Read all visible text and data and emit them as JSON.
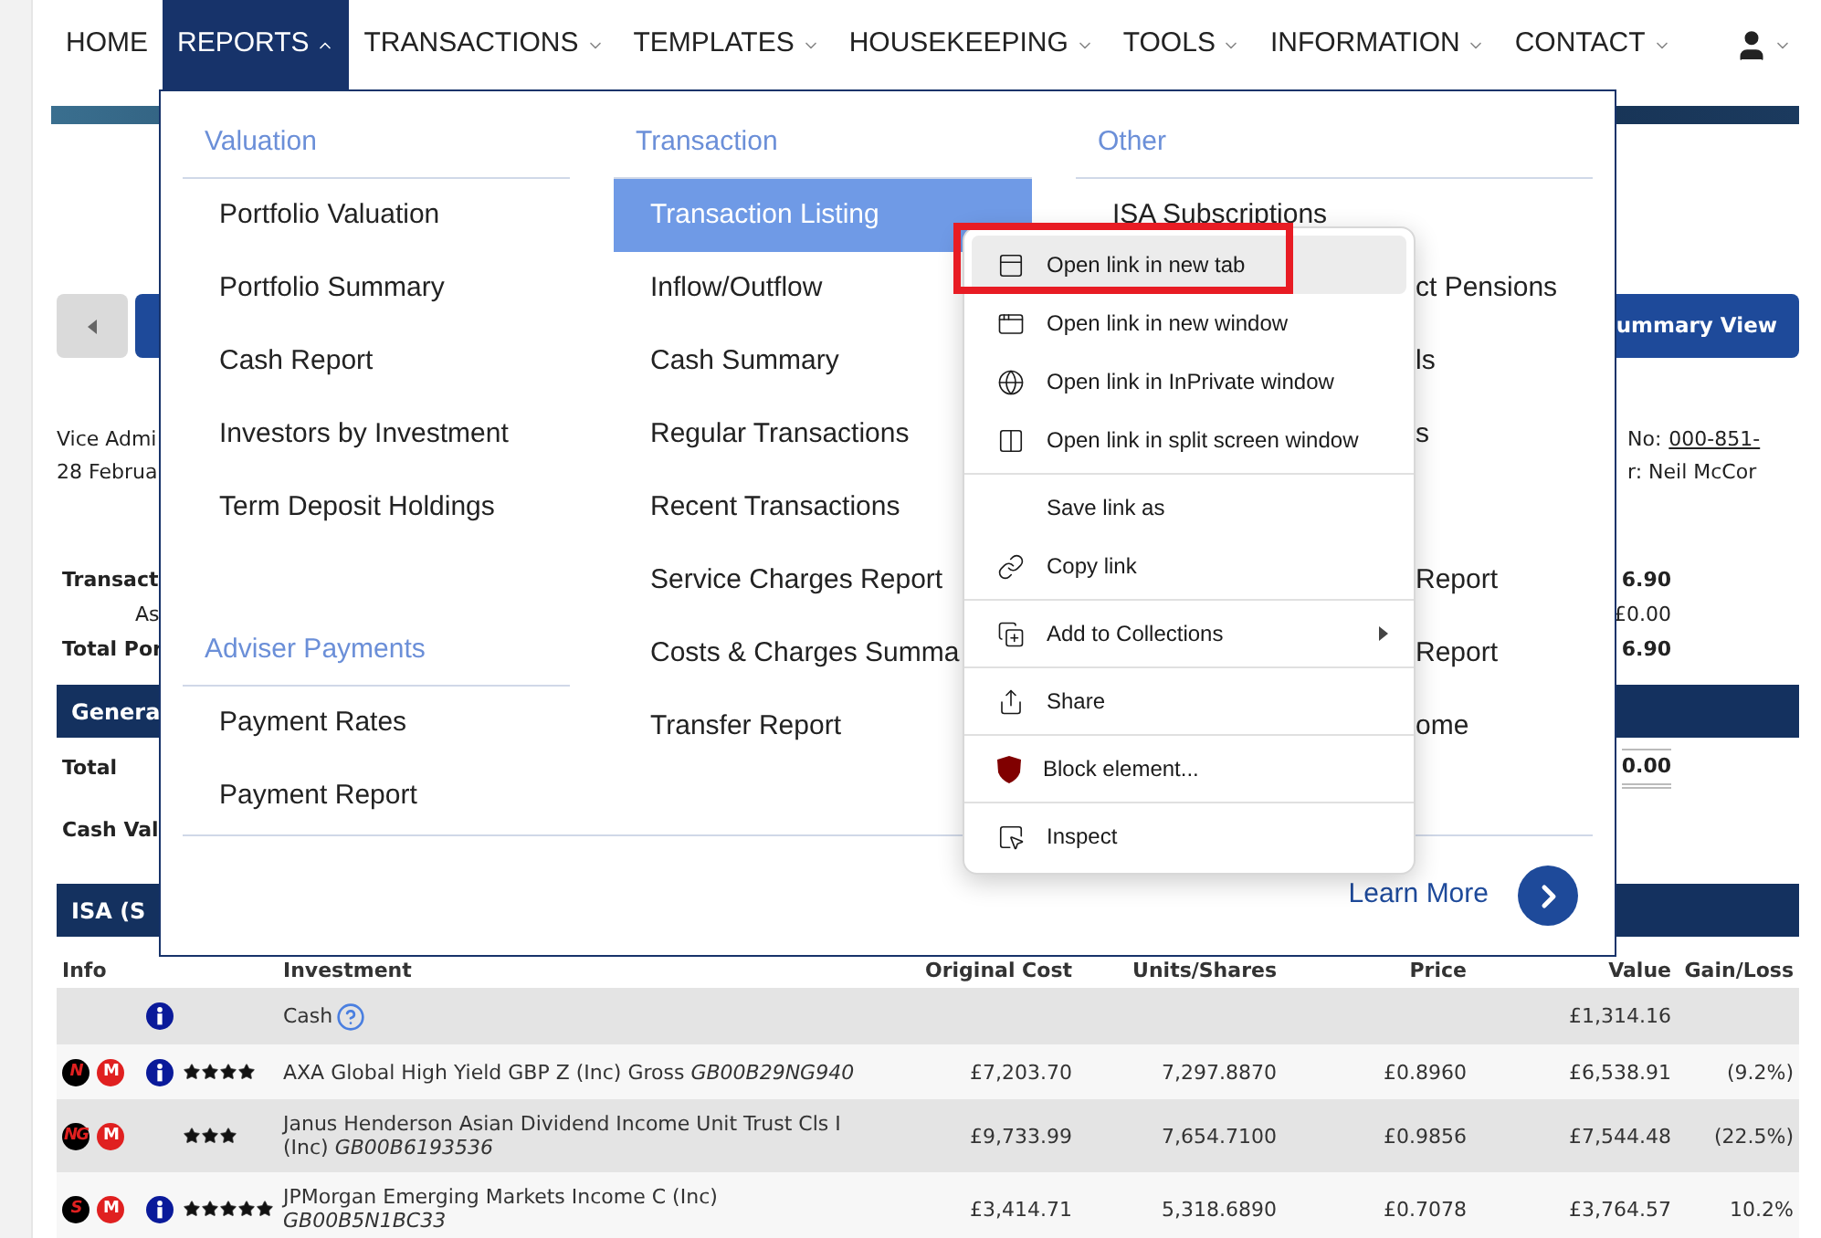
{
  "nav": [
    {
      "label": "HOME",
      "caret": false,
      "selected": false
    },
    {
      "label": "REPORTS",
      "caret": true,
      "selected": true
    },
    {
      "label": "TRANSACTIONS",
      "caret": true,
      "selected": false
    },
    {
      "label": "TEMPLATES",
      "caret": true,
      "selected": false
    },
    {
      "label": "HOUSEKEEPING",
      "caret": true,
      "selected": false
    },
    {
      "label": "TOOLS",
      "caret": true,
      "selected": false
    },
    {
      "label": "INFORMATION",
      "caret": true,
      "selected": false
    },
    {
      "label": "CONTACT",
      "caret": true,
      "selected": false
    }
  ],
  "summary_button": "ummary View",
  "client_lines": [
    {
      "left": "Vice Admi",
      "right_label": "No:",
      "right_value": "000-851-"
    },
    {
      "left": "28 Februa",
      "right_label": "r: Neil McCor"
    }
  ],
  "totals": [
    {
      "label": "Transact",
      "value": "6.90",
      "bold": true,
      "indent": false
    },
    {
      "label": "As",
      "value": "£0.00",
      "bold": false,
      "indent": true
    },
    {
      "label": "Total Por",
      "value": "6.90",
      "bold": true,
      "indent": false
    }
  ],
  "general": {
    "title": "Genera",
    "rows": [
      {
        "label": "Total",
        "value": "0.00"
      },
      {
        "label": "Cash Val"
      }
    ]
  },
  "isa": {
    "title": "ISA (S",
    "columns": [
      "Info",
      "Investment",
      "Original Cost",
      "Units/Shares",
      "Price",
      "Value",
      "Gain/Loss"
    ],
    "rows": [
      {
        "kind": "cash",
        "badges": [],
        "info": true,
        "investment": "Cash",
        "original_cost": "",
        "units": "",
        "price": "",
        "value": "£1,314.16",
        "gain_loss": ""
      },
      {
        "kind": "fund",
        "badges": [
          {
            "text": "N",
            "kind": "dark"
          },
          {
            "text": "M",
            "kind": "red"
          }
        ],
        "info": true,
        "stars": 4,
        "investment": "AXA Global High Yield GBP Z (Inc) Gross *GB00B29NG940*",
        "original_cost": "£7,203.70",
        "units": "7,297.8870",
        "price": "£0.8960",
        "value": "£6,538.91",
        "gain_loss": "(9.2%)"
      },
      {
        "kind": "fund",
        "badges": [
          {
            "text": "NG",
            "kind": "dark"
          },
          {
            "text": "M",
            "kind": "red"
          }
        ],
        "info": false,
        "stars": 3,
        "investment": "Janus Henderson Asian Dividend Income Unit Trust Cls I (Inc) *GB00B6193536*",
        "original_cost": "£9,733.99",
        "units": "7,654.7100",
        "price": "£0.9856",
        "value": "£7,544.48",
        "gain_loss": "(22.5%)"
      },
      {
        "kind": "fund",
        "badges": [
          {
            "text": "S",
            "kind": "dark"
          },
          {
            "text": "M",
            "kind": "red"
          }
        ],
        "info": true,
        "stars": 5,
        "investment": "JPMorgan Emerging Markets Income C (Inc) *GB00B5N1BC33*",
        "original_cost": "£3,414.71",
        "units": "5,318.6890",
        "price": "£0.7078",
        "value": "£3,764.57",
        "gain_loss": "10.2%"
      }
    ]
  },
  "mega_menu": {
    "columns": [
      {
        "sections": [
          {
            "heading": "Valuation",
            "items": [
              {
                "label": "Portfolio Valuation",
                "selected": false,
                "kind": "full"
              },
              {
                "label": "Portfolio Summary",
                "selected": false,
                "kind": "full"
              },
              {
                "label": "Cash Report",
                "selected": false,
                "kind": "full"
              },
              {
                "label": "Investors by Investment",
                "selected": false,
                "kind": "full"
              },
              {
                "label": "Term Deposit Holdings",
                "selected": false,
                "kind": "full"
              }
            ]
          },
          {
            "heading": "Adviser Payments",
            "items": [
              {
                "label": "Payment Rates",
                "selected": false,
                "kind": "full"
              },
              {
                "label": "Payment Report",
                "selected": false,
                "kind": "full"
              }
            ]
          }
        ]
      },
      {
        "sections": [
          {
            "heading": "Transaction",
            "items": [
              {
                "label": "Transaction Listing",
                "selected": true,
                "kind": "full"
              },
              {
                "label": "Inflow/Outflow",
                "selected": false,
                "kind": "full"
              },
              {
                "label": "Cash Summary",
                "selected": false,
                "kind": "full"
              },
              {
                "label": "Regular Transactions",
                "selected": false,
                "kind": "full"
              },
              {
                "label": "Recent Transactions",
                "selected": false,
                "kind": "full"
              },
              {
                "label": "Service Charges Report",
                "selected": false,
                "kind": "full"
              },
              {
                "label": "Costs & Charges Summa",
                "selected": false,
                "kind": "full"
              },
              {
                "label": "Transfer Report",
                "selected": false,
                "kind": "full"
              }
            ]
          }
        ]
      },
      {
        "sections": [
          {
            "heading": "Other",
            "items": [
              {
                "label": "ISA Subscriptions",
                "selected": false,
                "kind": "full"
              },
              {
                "label": "ct Pensions",
                "selected": false,
                "kind": "clipped"
              },
              {
                "label": "ls",
                "selected": false,
                "kind": "clipped"
              },
              {
                "label": "s",
                "selected": false,
                "kind": "clipped"
              },
              {
                "label": "Report",
                "selected": false,
                "kind": "clipped_after_gap"
              },
              {
                "label": "Report",
                "selected": false,
                "kind": "clipped"
              },
              {
                "label": "ome",
                "selected": false,
                "kind": "clipped"
              }
            ]
          }
        ]
      }
    ],
    "learn_more": "Learn More"
  },
  "context_menu": [
    {
      "kind": "item",
      "label": "Open link in new tab",
      "highlighted": true,
      "framed": true,
      "submenu": false
    },
    {
      "kind": "item",
      "label": "Open link in new window",
      "highlighted": false,
      "framed": false,
      "submenu": false
    },
    {
      "kind": "item",
      "label": "Open link in InPrivate window",
      "highlighted": false,
      "framed": false,
      "submenu": false
    },
    {
      "kind": "item",
      "label": "Open link in split screen window",
      "highlighted": false,
      "framed": false,
      "submenu": false
    },
    {
      "kind": "separator"
    },
    {
      "kind": "item",
      "label": "Save link as",
      "highlighted": false,
      "framed": false,
      "submenu": false
    },
    {
      "kind": "item",
      "label": "Copy link",
      "highlighted": false,
      "framed": false,
      "submenu": false
    },
    {
      "kind": "separator"
    },
    {
      "kind": "item",
      "label": "Add to Collections",
      "highlighted": false,
      "framed": false,
      "submenu": true
    },
    {
      "kind": "separator"
    },
    {
      "kind": "item",
      "label": "Share",
      "highlighted": false,
      "framed": false,
      "submenu": false
    },
    {
      "kind": "separator"
    },
    {
      "kind": "item",
      "label": "Block element...",
      "highlighted": false,
      "framed": false,
      "submenu": false
    },
    {
      "kind": "separator"
    },
    {
      "kind": "item",
      "label": "Inspect",
      "highlighted": false,
      "framed": false,
      "submenu": false
    }
  ]
}
